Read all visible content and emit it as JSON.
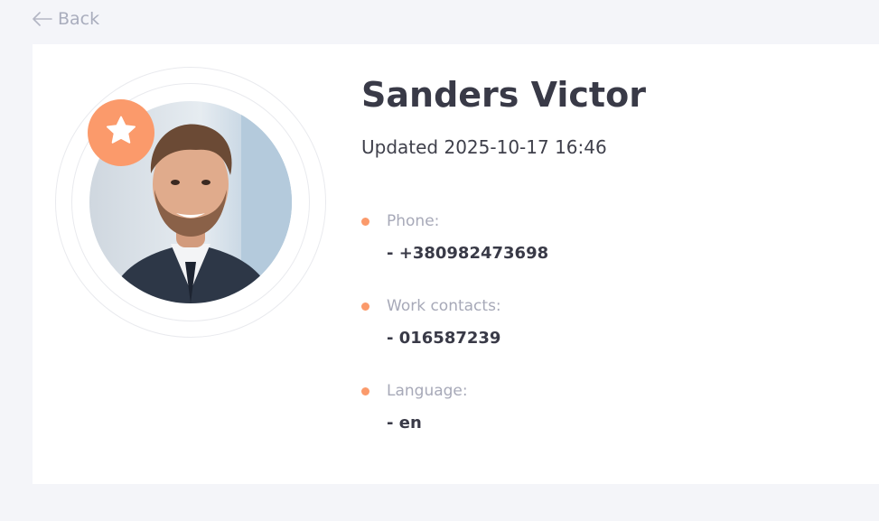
{
  "nav": {
    "back_label": "Back"
  },
  "profile": {
    "name": "Sanders Victor",
    "updated": "Updated 2025-10-17 16:46",
    "favorite": true
  },
  "contacts": [
    {
      "label": "Phone:",
      "value": "- +380982473698"
    },
    {
      "label": "Work contacts:",
      "value": "- 016587239"
    },
    {
      "label": "Language:",
      "value": "- en"
    }
  ],
  "colors": {
    "accent": "#fb9a6b",
    "background": "#f4f5f9",
    "card": "#ffffff",
    "heading": "#393a47",
    "muted": "#a7a9b8"
  },
  "icons": {
    "back": "arrow-left-icon",
    "favorite": "star-icon"
  }
}
